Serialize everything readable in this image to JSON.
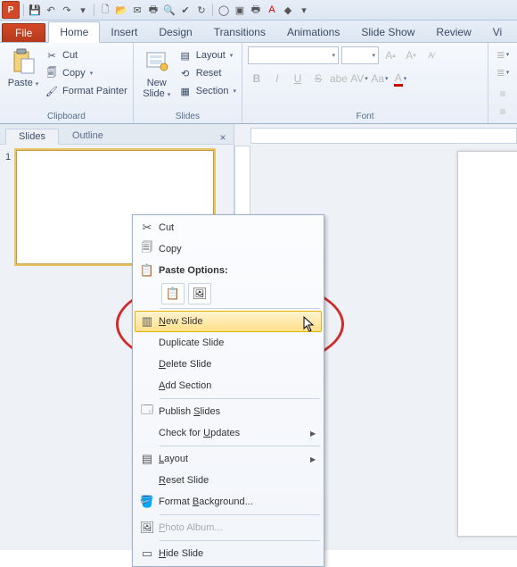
{
  "app": {
    "icon_letter": "P"
  },
  "tabs": {
    "file": "File",
    "items": [
      "Home",
      "Insert",
      "Design",
      "Transitions",
      "Animations",
      "Slide Show",
      "Review",
      "Vi"
    ],
    "active": 0
  },
  "ribbon": {
    "clipboard": {
      "label": "Clipboard",
      "paste": "Paste",
      "cut": "Cut",
      "copy": "Copy",
      "format_painter": "Format Painter"
    },
    "slides": {
      "label": "Slides",
      "new_slide": "New\nSlide",
      "layout": "Layout",
      "reset": "Reset",
      "section": "Section"
    },
    "font": {
      "label": "Font"
    }
  },
  "side": {
    "tabs": {
      "slides": "Slides",
      "outline": "Outline"
    },
    "slide_number": "1"
  },
  "context_menu": {
    "cut": "Cut",
    "copy": "Copy",
    "paste_options": "Paste Options:",
    "new_slide": "New Slide",
    "new_slide_mnemonic": "N",
    "duplicate_slide": "Duplicate Slide",
    "delete_slide": "Delete Slide",
    "delete_mnemonic": "D",
    "add_section": "Add Section",
    "add_mnemonic": "A",
    "publish_slides": "Publish Slides",
    "publish_mnemonic": "S",
    "check_updates": "Check for Updates",
    "check_mnemonic": "U",
    "layout": "Layout",
    "layout_mnemonic": "L",
    "reset_slide": "Reset Slide",
    "reset_mnemonic": "R",
    "format_bg": "Format Background...",
    "format_mnemonic": "B",
    "photo_album": "Photo Album...",
    "photo_mnemonic": "P",
    "hide_slide": "Hide Slide",
    "hide_mnemonic": "H"
  }
}
